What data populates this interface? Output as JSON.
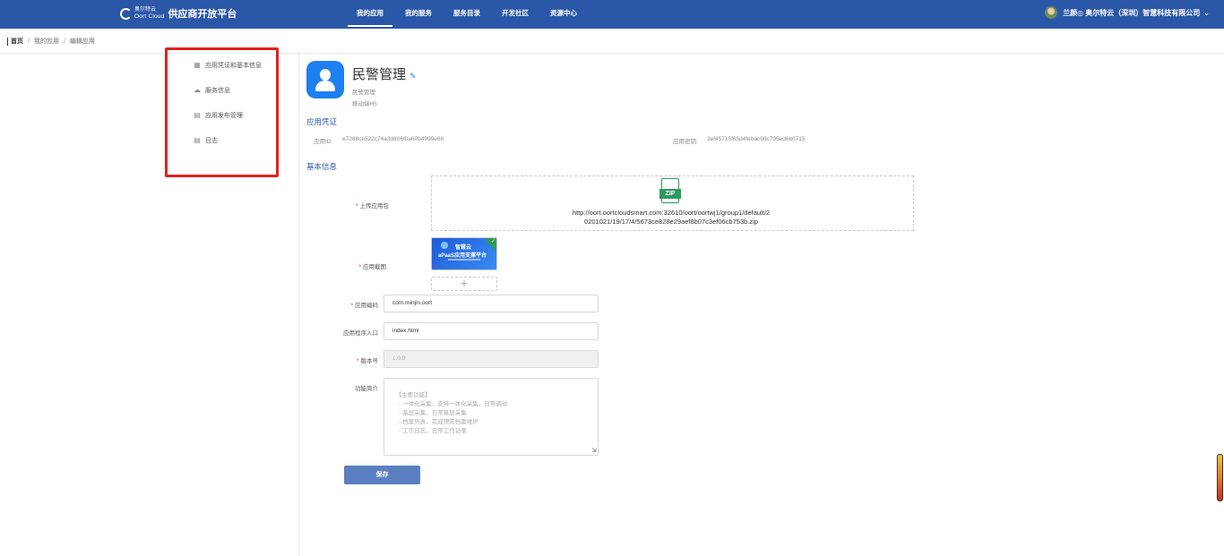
{
  "header": {
    "logo_cn": "奥尔特云",
    "logo_en": "Oort Cloud",
    "platform_title": "供应商开放平台",
    "nav": [
      {
        "label": "我的应用",
        "active": true
      },
      {
        "label": "我的服务",
        "active": false
      },
      {
        "label": "服务目录",
        "active": false
      },
      {
        "label": "开发社区",
        "active": false
      },
      {
        "label": "资源中心",
        "active": false
      }
    ],
    "user_name": "兰颜◎ 奥尔特云（深圳）智慧科技有限公司"
  },
  "breadcrumb": {
    "home": "首页",
    "items": [
      "我的应用",
      "编辑应用"
    ]
  },
  "menu": [
    {
      "icon": "grid-icon",
      "label": "应用凭证和基本信息"
    },
    {
      "icon": "cloud-icon",
      "label": "服务信息"
    },
    {
      "icon": "clipboard-icon",
      "label": "应用发布管理"
    },
    {
      "icon": "clipboard-icon",
      "label": "日志"
    }
  ],
  "app": {
    "name": "民警管理",
    "subtitle": "民警管理",
    "type": "移动端H5"
  },
  "credentials": {
    "title": "应用凭证",
    "app_id_label": "应用ID:",
    "app_id": "e7288ce522c74a3d806f0a60b4999e68",
    "app_secret_label": "应用密钥:",
    "app_secret": "3ef45715f65d4febac98c705ed6b0715"
  },
  "basic": {
    "title": "基本信息",
    "package_label": "上传应用包",
    "package_icon_label": "ZIP",
    "package_url": "http://oort.oortcloudsmart.com:32610/oort/oortwj1/group1/default/20201021/19/17/4/5673ce828e29aef8b07c3ef06cb753b.zip",
    "screenshot_label": "应用截图",
    "screenshot_title": "智慧云",
    "screenshot_subtitle": "aPaaS应用支撑平台",
    "add_symbol": "+",
    "code_label": "应用编码",
    "code_value": "com.minjin.oort",
    "entry_label": "应用程序入口",
    "entry_value": "index.html",
    "version_label": "版本号",
    "version_value": "1.0.9",
    "intro_label": "功能简介",
    "intro_value": "【主要功能】\n    - 一体化采集，支持一体化采集，日常调动\n    - 基层采集，日常基层采集\n    - 档案列表，完成预防档案维护\n    - 工作日志，日常工作记录",
    "save_label": "保存"
  },
  "colors": {
    "header_bg": "#2b57a8",
    "accent": "#2b57a8",
    "highlight_box": "#e0211e",
    "save_button": "#5a7fc0"
  }
}
